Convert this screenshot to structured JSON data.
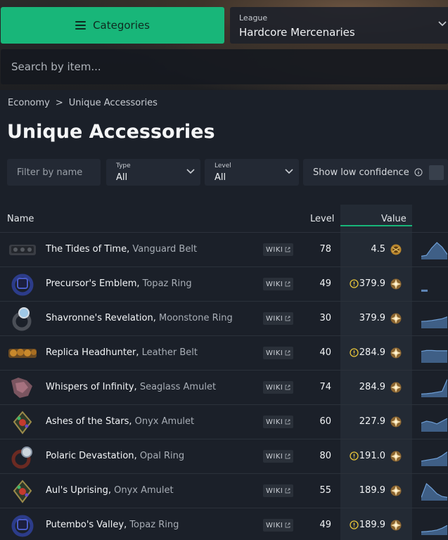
{
  "header": {
    "categories_label": "Categories",
    "league_label": "League",
    "league_value": "Hardcore Mercenaries",
    "search_placeholder": "Search by item..."
  },
  "breadcrumb": {
    "root": "Economy",
    "separator": ">",
    "current": "Unique Accessories"
  },
  "page_title": "Unique Accessories",
  "filters": {
    "name_placeholder": "Filter by name",
    "type_label": "Type",
    "type_value": "All",
    "level_label": "Level",
    "level_value": "All",
    "low_confidence_label": "Show low confidence",
    "low_confidence_checked": false
  },
  "table": {
    "columns": {
      "name": "Name",
      "level": "Level",
      "value": "Value"
    },
    "wiki_label": "WIKI",
    "accent_color": "#18b679",
    "rows": [
      {
        "name": "The Tides of Time",
        "base": "Vanguard Belt",
        "level": "78",
        "value": "4.5",
        "low_confidence": false,
        "currency_icon": "chaos-orb-icon",
        "item_icon": "vanguard-belt-icon",
        "trend": [
          0.1,
          0.15,
          0.55,
          0.85,
          0.6,
          0.2
        ]
      },
      {
        "name": "Precursor's Emblem",
        "base": "Topaz Ring",
        "level": "49",
        "value": "379.9",
        "low_confidence": true,
        "currency_icon": "divine-orb-icon",
        "item_icon": "topaz-ring-icon",
        "trend": [
          0.12,
          0.12
        ]
      },
      {
        "name": "Shavronne's Revelation",
        "base": "Moonstone Ring",
        "level": "30",
        "value": "379.9",
        "low_confidence": false,
        "currency_icon": "divine-orb-icon",
        "item_icon": "moonstone-ring-icon",
        "trend": [
          0.3,
          0.32,
          0.35,
          0.4,
          0.45,
          0.55
        ]
      },
      {
        "name": "Replica Headhunter",
        "base": "Leather Belt",
        "level": "40",
        "value": "284.9",
        "low_confidence": true,
        "currency_icon": "divine-orb-icon",
        "item_icon": "leather-belt-icon",
        "trend": [
          0.55,
          0.6,
          0.6,
          0.58,
          0.58,
          0.58
        ]
      },
      {
        "name": "Whispers of Infinity",
        "base": "Seaglass Amulet",
        "level": "74",
        "value": "284.9",
        "low_confidence": false,
        "currency_icon": "divine-orb-icon",
        "item_icon": "seaglass-amulet-icon",
        "trend": [
          0.1,
          0.12,
          0.15,
          0.2,
          0.25,
          0.9
        ]
      },
      {
        "name": "Ashes of the Stars",
        "base": "Onyx Amulet",
        "level": "60",
        "value": "227.9",
        "low_confidence": false,
        "currency_icon": "divine-orb-icon",
        "item_icon": "onyx-amulet-icon",
        "trend": [
          0.4,
          0.5,
          0.45,
          0.35,
          0.5,
          0.65
        ]
      },
      {
        "name": "Polaric Devastation",
        "base": "Opal Ring",
        "level": "80",
        "value": "191.0",
        "low_confidence": true,
        "currency_icon": "divine-orb-icon",
        "item_icon": "opal-ring-icon",
        "trend": [
          0.2,
          0.25,
          0.3,
          0.35,
          0.5,
          0.7
        ]
      },
      {
        "name": "Aul's Uprising",
        "base": "Onyx Amulet",
        "level": "55",
        "value": "189.9",
        "low_confidence": false,
        "currency_icon": "divine-orb-icon",
        "item_icon": "onyx-amulet-icon",
        "trend": [
          0.1,
          0.85,
          0.6,
          0.3,
          0.15,
          0.1
        ]
      },
      {
        "name": "Putembo's Valley",
        "base": "Topaz Ring",
        "level": "49",
        "value": "189.9",
        "low_confidence": true,
        "currency_icon": "divine-orb-icon",
        "item_icon": "topaz-ring-icon",
        "trend": [
          0.1,
          0.12,
          0.15,
          0.2,
          0.3,
          0.45
        ]
      }
    ]
  }
}
